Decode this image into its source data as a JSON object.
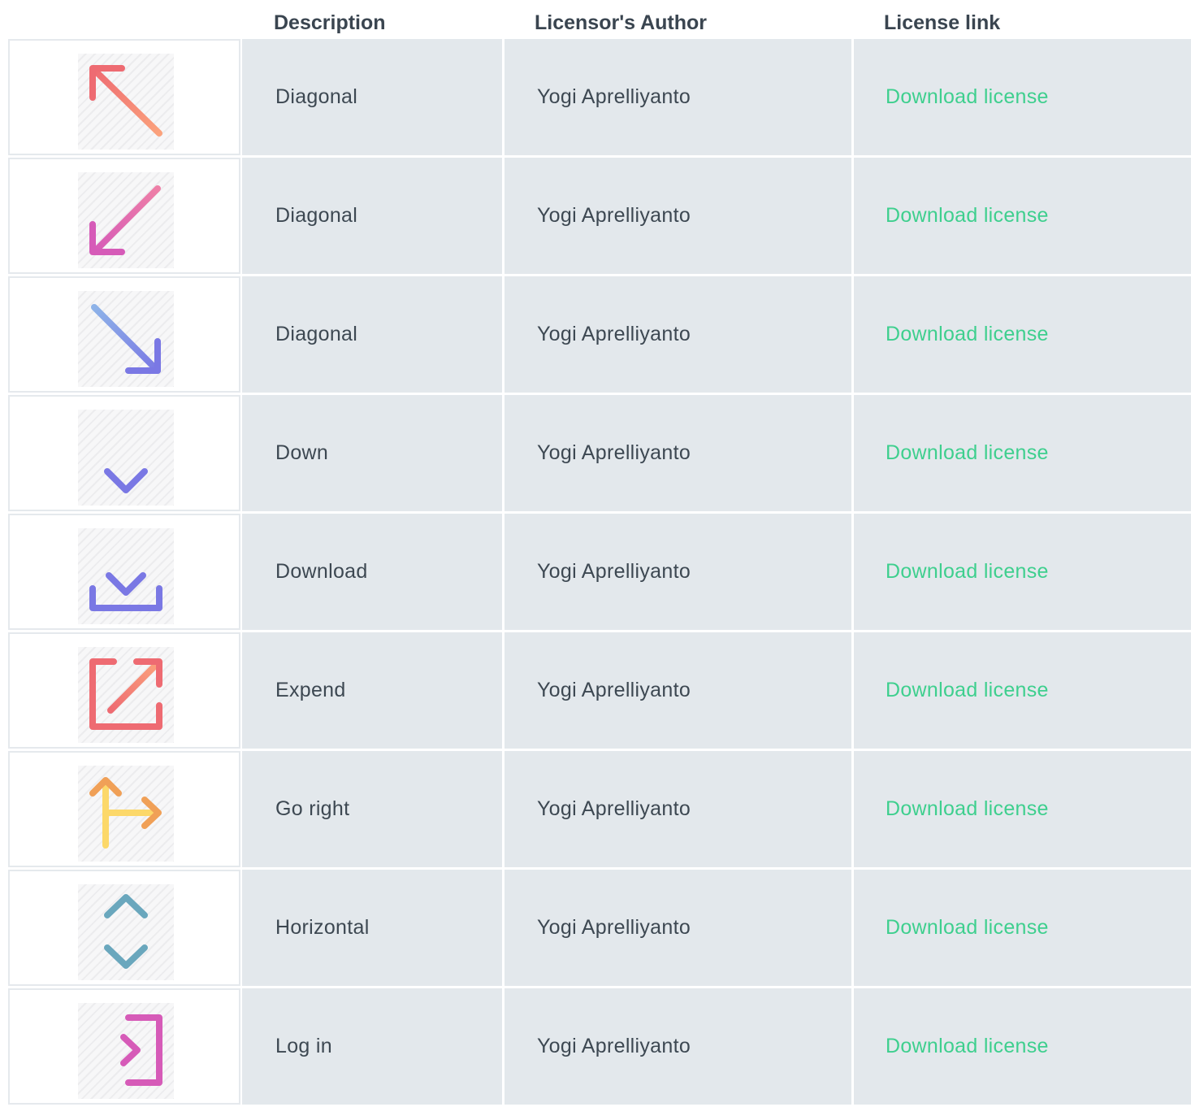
{
  "header": {
    "description": "Description",
    "author": "Licensor's Author",
    "link": "License link"
  },
  "rows": [
    {
      "icon": "arrow-up-left-icon",
      "description": "Diagonal",
      "author": "Yogi Aprelliyanto",
      "link": "Download license"
    },
    {
      "icon": "arrow-down-left-icon",
      "description": "Diagonal",
      "author": "Yogi Aprelliyanto",
      "link": "Download license"
    },
    {
      "icon": "arrow-down-right-icon",
      "description": "Diagonal",
      "author": "Yogi Aprelliyanto",
      "link": "Download license"
    },
    {
      "icon": "arrow-down-icon",
      "description": "Down",
      "author": "Yogi Aprelliyanto",
      "link": "Download license"
    },
    {
      "icon": "download-icon",
      "description": "Download",
      "author": "Yogi Aprelliyanto",
      "link": "Download license"
    },
    {
      "icon": "expand-icon",
      "description": "Expend",
      "author": "Yogi Aprelliyanto",
      "link": "Download license"
    },
    {
      "icon": "go-right-icon",
      "description": "Go right",
      "author": "Yogi Aprelliyanto",
      "link": "Download license"
    },
    {
      "icon": "vertical-arrows-icon",
      "description": "Horizontal",
      "author": "Yogi Aprelliyanto",
      "link": "Download license"
    },
    {
      "icon": "log-in-icon",
      "description": "Log in",
      "author": "Yogi Aprelliyanto",
      "link": "Download license"
    }
  ],
  "colors": {
    "link": "#3ecf8e",
    "cell_background": "#e3e8ec",
    "text": "#3d4852"
  }
}
